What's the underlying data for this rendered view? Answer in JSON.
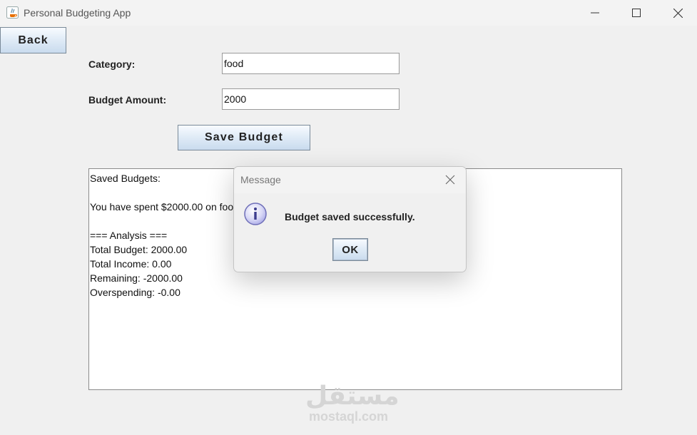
{
  "window": {
    "title": "Personal Budgeting App"
  },
  "back_button": {
    "label": "Back"
  },
  "form": {
    "category_label": "Category:",
    "category_value": "food",
    "amount_label": "Budget Amount:",
    "amount_value": "2000",
    "save_label": "Save Budget"
  },
  "output": {
    "lines": [
      "Saved Budgets:",
      "",
      "You have spent $2000.00 on food",
      "",
      "=== Analysis ===",
      "Total Budget: 2000.00",
      "Total Income: 0.00",
      "Remaining: -2000.00",
      "Overspending: -0.00"
    ]
  },
  "dialog": {
    "title": "Message",
    "message": "Budget saved successfully.",
    "ok_label": "OK",
    "icon": "information-icon"
  },
  "watermark": {
    "logo": "مستقل",
    "text": "mostaql.com"
  }
}
